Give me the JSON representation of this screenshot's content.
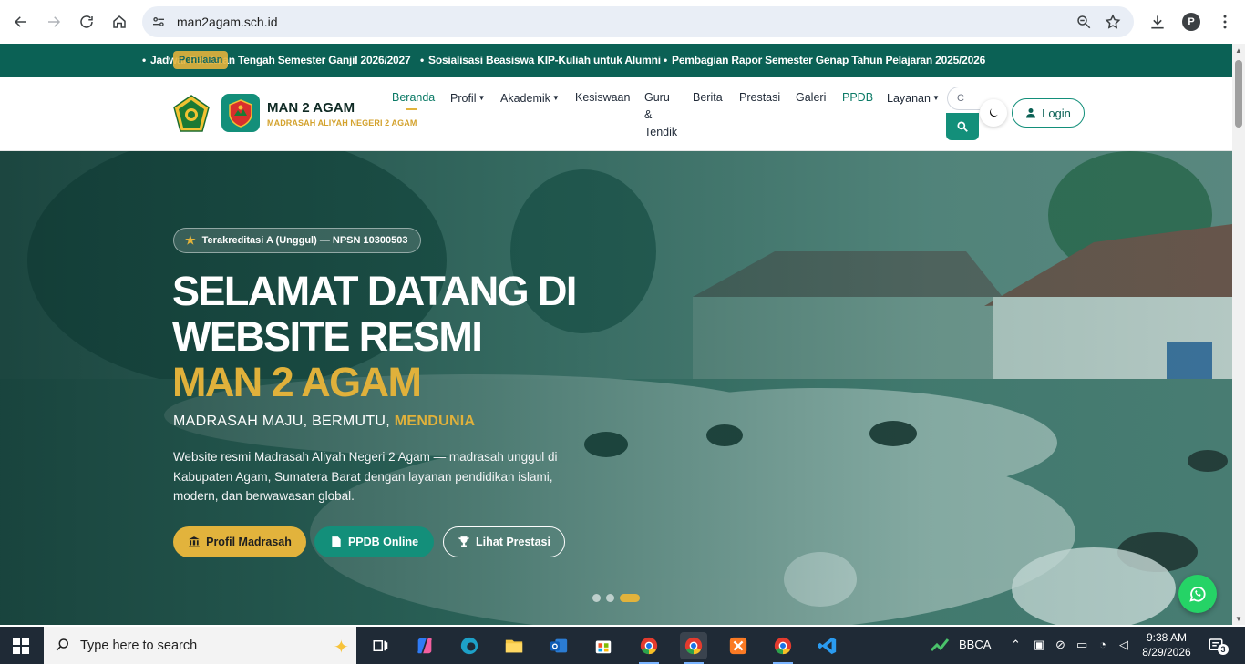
{
  "browser": {
    "url": "man2agam.sch.id",
    "profile_initial": "P"
  },
  "ticker": {
    "badge": "Penilaian",
    "items": [
      "Jadwal Penilaian Tengah Semester Ganjil 2026/2027",
      "Sosialisasi Beasiswa KIP-Kuliah untuk Alumni",
      "Pembagian Rapor Semester Genap Tahun Pelajaran 2025/2026"
    ]
  },
  "header": {
    "brand_title": "MAN 2 AGAM",
    "brand_subtitle": "MADRASAH ALIYAH NEGERI 2 AGAM",
    "menu": {
      "beranda": "Beranda",
      "profil": "Profil",
      "akademik": "Akademik",
      "kesiswaan": "Kesiswaan",
      "guru_1": "Guru",
      "guru_2": "&",
      "guru_3": "Tendik",
      "berita": "Berita",
      "prestasi": "Prestasi",
      "galeri": "Galeri",
      "ppdb": "PPDB",
      "layanan": "Layanan"
    },
    "search_placeholder": "C",
    "login_label": "Login",
    "colors": {
      "primary": "#138f7a",
      "dark": "#0b6155",
      "accent": "#e2b33c"
    }
  },
  "hero": {
    "badge": "Terakreditasi A (Unggul) — NPSN 10300503",
    "title_line1": "SELAMAT DATANG DI",
    "title_line2": "WEBSITE RESMI",
    "title_line3": "MAN 2 AGAM",
    "tagline_prefix": "MADRASAH MAJU, BERMUTU,",
    "tagline_highlight": "MENDUNIA",
    "description": "Website resmi Madrasah Aliyah Negeri 2 Agam — madrasah unggul di Kabupaten Agam, Sumatera Barat dengan layanan pendidikan islami, modern, dan berwawasan global.",
    "buttons": {
      "profil": "Profil Madrasah",
      "ppdb": "PPDB Online",
      "prestasi": "Lihat Prestasi"
    }
  },
  "taskbar": {
    "search_placeholder": "Type here to search",
    "stock_label": "BBCA",
    "time": "9:38 AM",
    "date": "8/29/2026",
    "notification_count": "3"
  }
}
